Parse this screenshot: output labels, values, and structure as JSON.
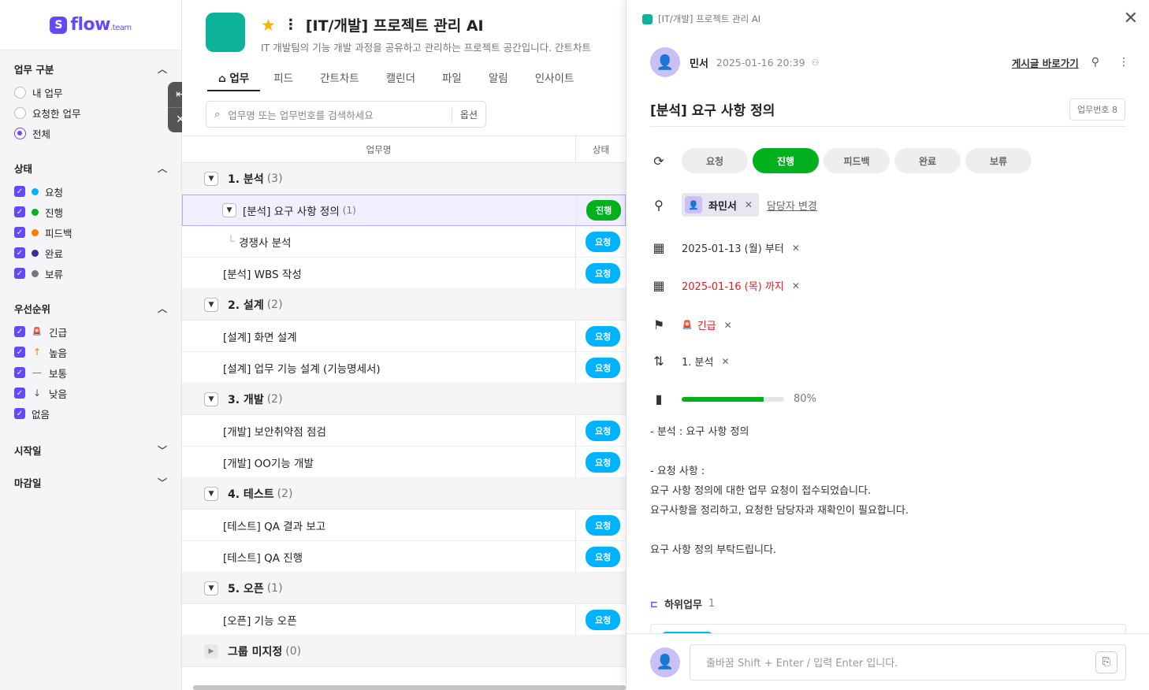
{
  "logo": {
    "mark": "S",
    "word": "flow",
    "suffix": ".team"
  },
  "sidebar": {
    "work_type": {
      "title": "업무 구분",
      "options": [
        {
          "label": "내 업무",
          "selected": false
        },
        {
          "label": "요청한 업무",
          "selected": false
        },
        {
          "label": "전체",
          "selected": true
        }
      ]
    },
    "status": {
      "title": "상태",
      "items": [
        {
          "label": "요청",
          "color": "#00b2ff"
        },
        {
          "label": "진행",
          "color": "#00b01c"
        },
        {
          "label": "피드백",
          "color": "#fd7900"
        },
        {
          "label": "완료",
          "color": "#402a9d"
        },
        {
          "label": "보류",
          "color": "#777777"
        }
      ]
    },
    "priority": {
      "title": "우선순위",
      "items": [
        {
          "label": "긴급",
          "icon": "siren-icon",
          "glyph": "🚨",
          "color": "#e21c1c"
        },
        {
          "label": "높음",
          "icon": "arrow-up-icon",
          "glyph": "↑",
          "color": "#fd7900"
        },
        {
          "label": "보통",
          "icon": "dash-icon",
          "glyph": "—",
          "color": "#00b01c"
        },
        {
          "label": "낮음",
          "icon": "arrow-down-icon",
          "glyph": "↓",
          "color": "#555555"
        },
        {
          "label": "없음",
          "icon": "",
          "glyph": "",
          "color": ""
        }
      ]
    },
    "start_date": {
      "title": "시작일"
    },
    "due_date": {
      "title": "마감일"
    }
  },
  "project": {
    "title": "[IT/개발] 프로젝트 관리 AI",
    "description": "IT 개발팀의 기능 개발 과정을 공유하고 관리하는 프로젝트 공간입니다. 간트차트",
    "tabs": [
      "업무",
      "피드",
      "간트차트",
      "캘린더",
      "파일",
      "알림",
      "인사이트"
    ],
    "active_tab": "업무"
  },
  "search": {
    "placeholder": "업무명 또는 업무번호를 검색하세요",
    "options_label": "옵션"
  },
  "table": {
    "headers": {
      "name": "업무명",
      "status": "상태"
    },
    "rows": [
      {
        "type": "group",
        "label": "1. 분석",
        "count": "(3)"
      },
      {
        "type": "task",
        "label": "[분석] 요구 사항 정의",
        "count": "(1)",
        "status": "진행",
        "selected": true,
        "caret": true
      },
      {
        "type": "subtask",
        "label": "경쟁사 분석",
        "status": "요청"
      },
      {
        "type": "task",
        "label": "[분석] WBS 작성",
        "status": "요청"
      },
      {
        "type": "group",
        "label": "2. 설계",
        "count": "(2)"
      },
      {
        "type": "task",
        "label": "[설계] 화면 설계",
        "status": "요청"
      },
      {
        "type": "task",
        "label": "[설계] 업무 기능 설계 (기능명세서)",
        "status": "요청"
      },
      {
        "type": "group",
        "label": "3. 개발",
        "count": "(2)"
      },
      {
        "type": "task",
        "label": "[개발] 보안취약점 점검",
        "status": "요청"
      },
      {
        "type": "task",
        "label": "[개발] OO기능 개발",
        "status": "요청"
      },
      {
        "type": "group",
        "label": "4. 테스트",
        "count": "(2)"
      },
      {
        "type": "task",
        "label": "[테스트] QA 결과 보고",
        "status": "요청"
      },
      {
        "type": "task",
        "label": "[테스트] QA 진행",
        "status": "요청"
      },
      {
        "type": "group",
        "label": "5. 오픈",
        "count": "(1)"
      },
      {
        "type": "task",
        "label": "[오픈] 기능 오픈",
        "status": "요청"
      },
      {
        "type": "group-collapsed",
        "label": "그룹 미지정",
        "count": "(0)"
      }
    ]
  },
  "detail": {
    "breadcrumb": "[IT/개발] 프로젝트 관리 AI",
    "author": "민서",
    "date": "2025-01-16 20:39",
    "goto_post": "게시글 바로가기",
    "title": "[분석] 요구 사항 정의",
    "task_no": "업무번호 8",
    "statuses": [
      "요청",
      "진행",
      "피드백",
      "완료",
      "보류"
    ],
    "active_status": "진행",
    "assignee": "좌민서",
    "change_assignee": "담당자 변경",
    "start": "2025-01-13 (월) 부터",
    "due": "2025-01-16 (목) 까지",
    "priority": "긴급",
    "group": "1. 분석",
    "progress": 80,
    "progress_label": "80%",
    "content": "- 분석 : 요구 사항 정의\n\n- 요청 사항 :\n요구 사항 정의에 대한 업무 요청이 접수되었습니다.\n요구사항을 정리하고, 요청한 담당자과 재확인이 필요합니다.\n\n요구 사항 정의 부탁드립니다.",
    "subtasks_label": "하위업무",
    "subtasks_count": "1",
    "comment_placeholder": "줄바꿈 Shift + Enter / 입력 Enter 입니다.",
    "colors": {
      "progress": "#00b01c",
      "accent": "#6449fc",
      "urgent": "#e21c1c"
    }
  }
}
